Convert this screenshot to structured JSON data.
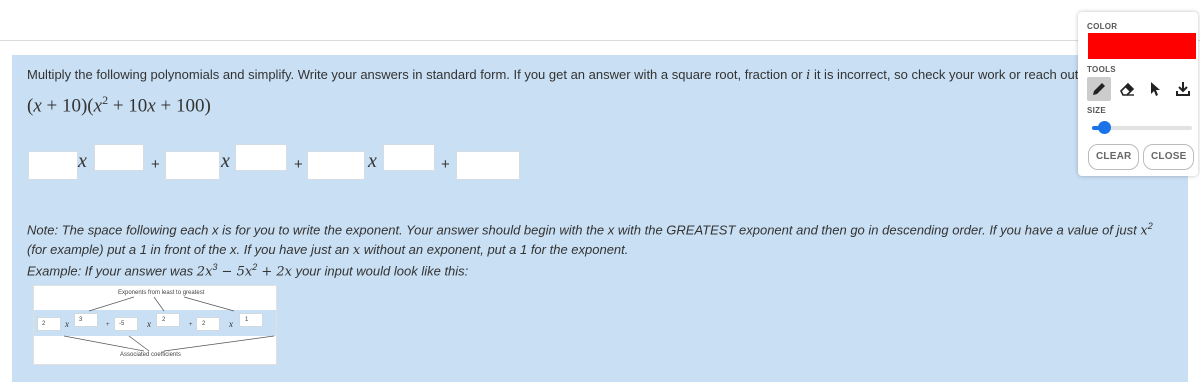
{
  "question": {
    "instructions": "Multiply the following polynomials and simplify.  Write your answers in standard form.  If you get an answer with a square root, fraction or ",
    "instructions_i": "i",
    "instructions_tail": " it is incorrect, so check your work or reach out t",
    "expression_parts": [
      "(",
      "x",
      " + 10)(",
      "x",
      "2",
      " + 10",
      "x",
      " + 100)"
    ]
  },
  "answer_row": {
    "variable": "x",
    "plus": "+",
    "coefficients": [
      "",
      "",
      "",
      ""
    ],
    "exponents": [
      "",
      "",
      ""
    ]
  },
  "note": {
    "line1_a": "Note:  The space following each x is for you to write the exponent.  Your answer should begin with the x with the GREATEST exponent and then go in descending order.  If you have a value of just ",
    "line1_b": " (for example) put a 1 in front of the x.  If you have just an ",
    "line1_c": " without an exponent, put a 1 for the exponent.",
    "x": "x",
    "sq": "2"
  },
  "example": {
    "lead": "Example:  If your answer was ",
    "math": "2x",
    "math_exp": "3",
    "math_rest": " − 5x",
    "math_rest_exp": "2",
    "math_tail": " + 2x",
    "trail": " your input would look like this:"
  },
  "example_image": {
    "top_label": "Exponents from least to greatest",
    "bottom_label": "Associated coefficients",
    "coefficients": [
      "2",
      "-5",
      "2"
    ],
    "exponents": [
      "3",
      "2",
      "1"
    ],
    "variable": "x",
    "plus": "+"
  },
  "toolbar": {
    "color_label": "COLOR",
    "color_value": "#ff0000",
    "tools_label": "TOOLS",
    "size_label": "SIZE",
    "size_level": 0.1,
    "clear_label": "CLEAR",
    "close_label": "CLOSE",
    "tools": [
      "pencil-icon",
      "eraser-icon",
      "pointer-icon",
      "download-icon"
    ]
  }
}
